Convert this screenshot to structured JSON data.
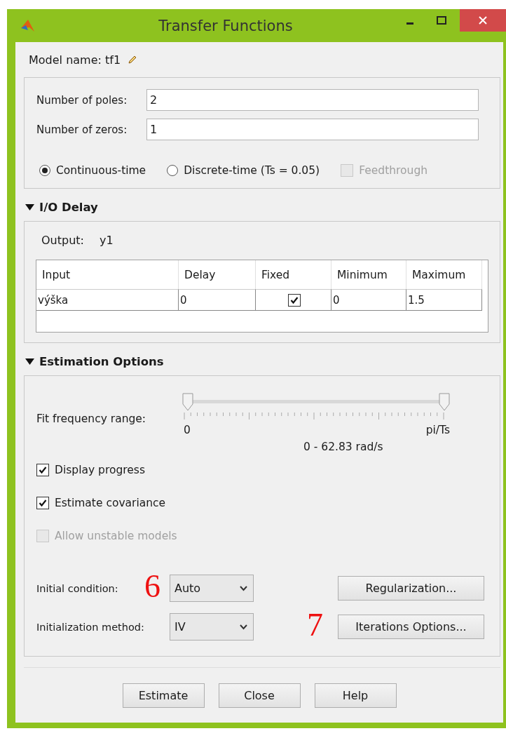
{
  "window": {
    "title": "Transfer Functions"
  },
  "model_name": {
    "label": "Model name: tf1"
  },
  "structure": {
    "fields": [
      {
        "label": "Number of poles:",
        "value": "2"
      },
      {
        "label": "Number of zeros:",
        "value": "1"
      }
    ],
    "time_options": [
      {
        "kind": "radio",
        "label": "Continuous-time",
        "selected": true,
        "disabled": false
      },
      {
        "kind": "radio",
        "label": "Discrete-time (Ts = 0.05)",
        "selected": false,
        "disabled": false
      },
      {
        "kind": "checkbox",
        "label": "Feedthrough",
        "checked": false,
        "disabled": true
      }
    ]
  },
  "io_delay": {
    "title": "I/O Delay",
    "expanded": true,
    "output_label": "Output:",
    "output_value": "y1",
    "table": {
      "columns": [
        "Input",
        "Delay",
        "Fixed",
        "Minimum",
        "Maximum"
      ],
      "rows": [
        {
          "input": "výška",
          "delay": "0",
          "fixed": true,
          "minimum": "0",
          "maximum": "1.5"
        }
      ]
    }
  },
  "estimation": {
    "title": "Estimation Options",
    "expanded": true,
    "fit_range": {
      "label": "Fit frequency range:",
      "thumbs": [
        {
          "level": 0
        },
        {
          "level": 1
        }
      ],
      "min_label": "0",
      "max_label": "pi/Ts",
      "reading": "0 - 62.83 rad/s"
    },
    "checkboxes": [
      {
        "label": "Display progress",
        "checked": true,
        "disabled": false
      },
      {
        "label": "Estimate covariance",
        "checked": true,
        "disabled": false
      },
      {
        "label": "Allow unstable models",
        "checked": false,
        "disabled": true
      }
    ],
    "dropdowns": [
      {
        "label": "Initial condition:",
        "value": "Auto",
        "button": "Regularization...",
        "annotation": "6"
      },
      {
        "label": "Initialization method:",
        "value": "IV",
        "button": "Iterations Options...",
        "annotation": "7"
      }
    ]
  },
  "buttons": [
    "Estimate",
    "Close",
    "Help"
  ]
}
